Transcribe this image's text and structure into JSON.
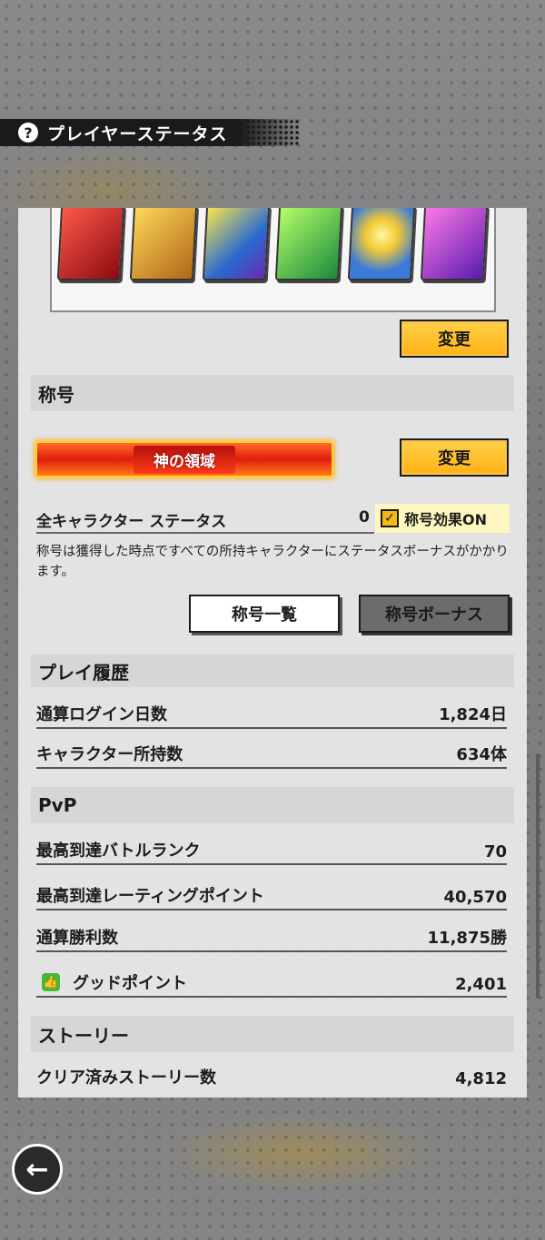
{
  "header": {
    "title": "プレイヤーステータス",
    "help_icon": "?"
  },
  "skill_icons": [
    {
      "name": "fist-skill-icon",
      "color": "#c8202a"
    },
    {
      "name": "fireball-skill-icon",
      "color": "#e6a02a"
    },
    {
      "name": "burst-skill-icon",
      "color": "#2f7ed8"
    },
    {
      "name": "sparkle-skill-icon",
      "color": "#35b24a"
    },
    {
      "name": "blast-skill-icon",
      "color": "#f2c934"
    },
    {
      "name": "aura-skill-icon",
      "color": "#9a3fd6"
    }
  ],
  "buttons": {
    "change_skill": "変更",
    "change_title": "変更",
    "title_list": "称号一覧",
    "title_bonus": "称号ボーナス"
  },
  "title_section": {
    "heading": "称号",
    "current_title": "神の領域",
    "status_label": "全キャラクター ステータス",
    "status_value": "0",
    "effect_toggle_label": "称号効果ON",
    "effect_on": true,
    "note": "称号は獲得した時点ですべての所持キャラクターにステータスボーナスがかかります。"
  },
  "play_history": {
    "heading": "プレイ履歴",
    "rows": [
      {
        "label": "通算ログイン日数",
        "value": "1,824日"
      },
      {
        "label": "キャラクター所持数",
        "value": "634体"
      }
    ]
  },
  "pvp": {
    "heading": "PvP",
    "rows": [
      {
        "label": "最高到達バトルランク",
        "value": "70"
      },
      {
        "label": "最高到達レーティングポイント",
        "value": "40,570"
      },
      {
        "label": "通算勝利数",
        "value": "11,875勝"
      },
      {
        "label": "グッドポイント",
        "value": "2,401"
      }
    ]
  },
  "story": {
    "heading": "ストーリー",
    "rows": [
      {
        "label": "クリア済みストーリー数",
        "value": "4,812"
      }
    ]
  },
  "back_button": "←"
}
